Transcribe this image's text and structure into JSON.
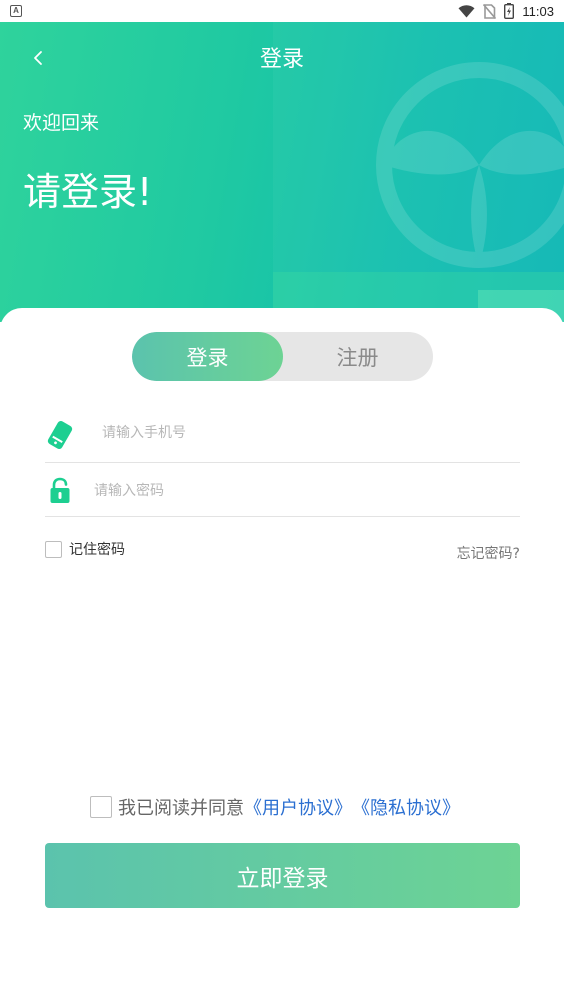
{
  "status_bar": {
    "time": "11:03",
    "app_icon_letter": "A"
  },
  "header": {
    "title": "登录",
    "welcome": "欢迎回来",
    "prompt": "请登录!"
  },
  "tabs": {
    "login": "登录",
    "register": "注册",
    "active": "login"
  },
  "form": {
    "phone_placeholder": "请输入手机号",
    "password_placeholder": "请输入密码",
    "remember_label": "记住密码",
    "forgot_label": "忘记密码?"
  },
  "agreement": {
    "prefix": "我已阅读并同意",
    "user_agreement": "《用户协议》",
    "privacy_policy": "《隐私协议》"
  },
  "submit_label": "立即登录",
  "colors": {
    "brand_green": "#2fd39c",
    "brand_teal": "#0db7b5",
    "gradient_start": "#5bc3ad",
    "gradient_end": "#6dd394",
    "link_blue": "#2b6fd1",
    "icon_green": "#1dcf91"
  },
  "icons": [
    "back-icon",
    "wifi-icon",
    "no-sim-icon",
    "battery-charging-icon",
    "phone-icon",
    "lock-icon"
  ]
}
